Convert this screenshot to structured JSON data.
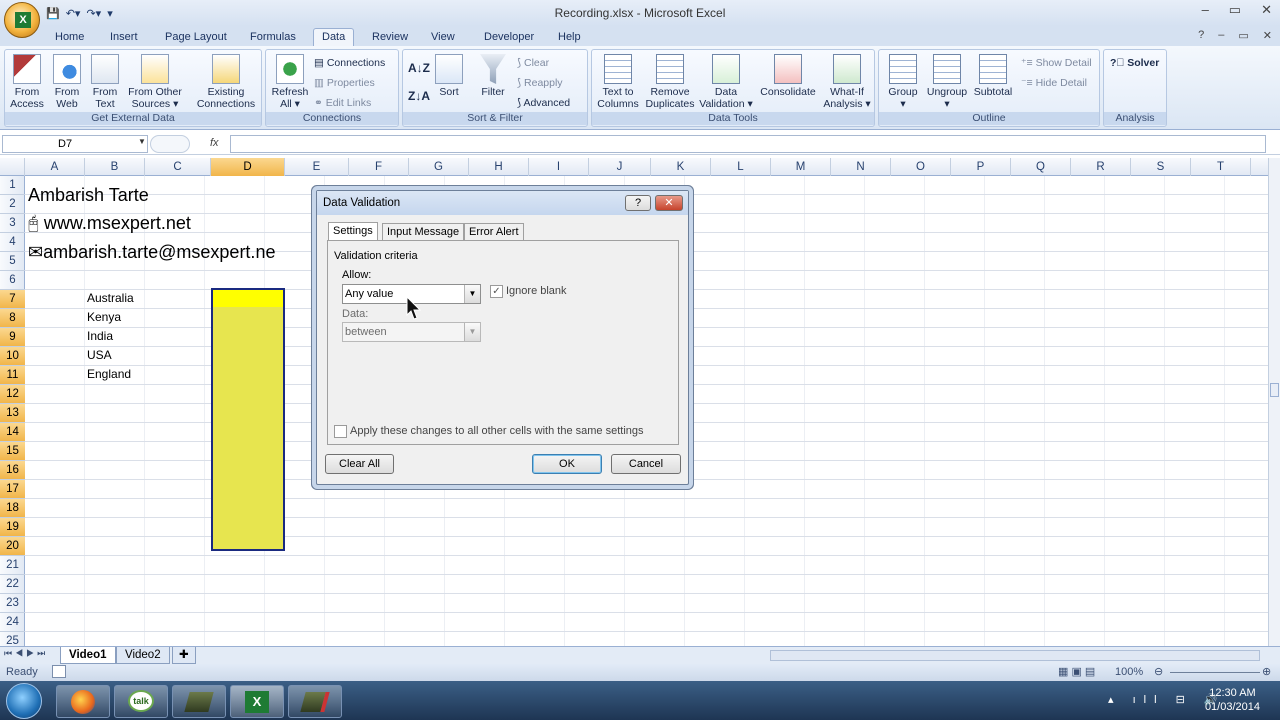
{
  "window": {
    "title": "Recording.xlsx - Microsoft Excel",
    "controls": [
      "–",
      "▭",
      "✕"
    ]
  },
  "ribbon_tabs": [
    "Home",
    "Insert",
    "Page Layout",
    "Formulas",
    "Data",
    "Review",
    "View",
    "Developer",
    "Help"
  ],
  "active_tab": "Data",
  "ribbon": {
    "get_external_data": {
      "label": "Get External Data",
      "buttons": [
        {
          "l1": "From",
          "l2": "Access"
        },
        {
          "l1": "From",
          "l2": "Web"
        },
        {
          "l1": "From",
          "l2": "Text"
        },
        {
          "l1": "From Other",
          "l2": "Sources ▾"
        },
        {
          "l1": "Existing",
          "l2": "Connections"
        }
      ]
    },
    "connections": {
      "label": "Connections",
      "refresh": {
        "l1": "Refresh",
        "l2": "All ▾"
      },
      "connections": "Connections",
      "properties": "Properties",
      "edit_links": "Edit Links"
    },
    "sort_filter": {
      "label": "Sort & Filter",
      "sort": "Sort",
      "filter": "Filter",
      "clear": "Clear",
      "reapply": "Reapply",
      "advanced": "Advanced"
    },
    "data_tools": {
      "label": "Data Tools",
      "buttons": [
        {
          "l1": "Text to",
          "l2": "Columns"
        },
        {
          "l1": "Remove",
          "l2": "Duplicates"
        },
        {
          "l1": "Data",
          "l2": "Validation ▾"
        },
        {
          "l1": "Consolidate",
          "l2": ""
        },
        {
          "l1": "What-If",
          "l2": "Analysis ▾"
        }
      ]
    },
    "outline": {
      "label": "Outline",
      "group": "Group",
      "ungroup": "Ungroup",
      "subtotal": "Subtotal",
      "show_detail": "Show Detail",
      "hide_detail": "Hide Detail"
    },
    "analysis": {
      "label": "Analysis",
      "solver": "Solver"
    }
  },
  "formula_bar": {
    "name_box": "D7",
    "fx": "fx",
    "value": ""
  },
  "columns": [
    "A",
    "B",
    "C",
    "D",
    "E",
    "F",
    "G",
    "H",
    "I",
    "J",
    "K",
    "L",
    "M",
    "N",
    "O",
    "P",
    "Q",
    "R",
    "S",
    "T"
  ],
  "rows": [
    "1",
    "2",
    "3",
    "4",
    "5",
    "6",
    "7",
    "8",
    "9",
    "10",
    "11",
    "12",
    "13",
    "14",
    "15",
    "16",
    "17",
    "18",
    "19",
    "20",
    "21",
    "22",
    "23",
    "24",
    "25"
  ],
  "cells": {
    "name": "Ambarish Tarte",
    "website": "www.msexpert.net",
    "email": "ambarish.tarte@msexpert.ne",
    "website_icon": "🖰",
    "email_icon": "✉",
    "countries": [
      "Australia",
      "Kenya",
      "India",
      "USA",
      "England"
    ]
  },
  "sheets": [
    "Video1",
    "Video2"
  ],
  "status": {
    "ready": "Ready",
    "zoom": "100%"
  },
  "clock": {
    "time": "12:30 AM",
    "date": "01/03/2014"
  },
  "dialog": {
    "title": "Data Validation",
    "tabs": [
      "Settings",
      "Input Message",
      "Error Alert"
    ],
    "section": "Validation criteria",
    "allow_label": "Allow:",
    "allow_value": "Any value",
    "ignore_blank": "Ignore blank",
    "data_label": "Data:",
    "data_value": "between",
    "apply_all": "Apply these changes to all other cells with the same settings",
    "clear_all": "Clear All",
    "ok": "OK",
    "cancel": "Cancel"
  }
}
